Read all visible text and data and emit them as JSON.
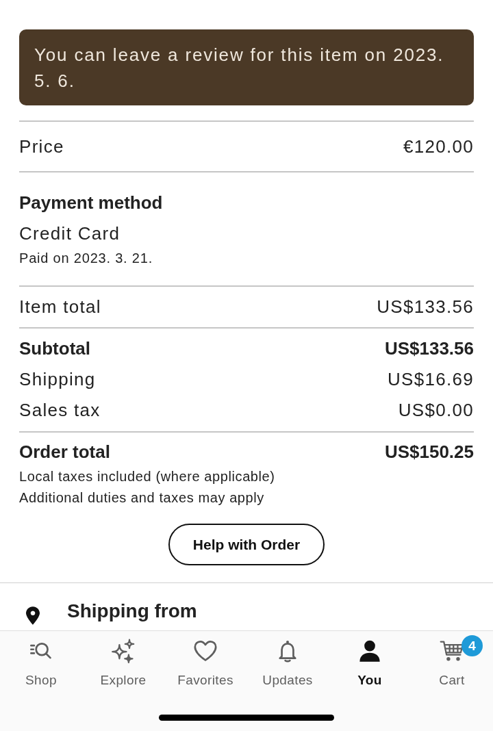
{
  "review_notice": {
    "text": "You can leave a review for this item on 2023. 5. 6."
  },
  "price": {
    "label": "Price",
    "value": "€120.00"
  },
  "payment_method": {
    "heading": "Payment method",
    "method": "Credit Card",
    "paid_on": "Paid on 2023. 3. 21."
  },
  "item_total": {
    "label": "Item total",
    "value": "US$133.56"
  },
  "charges": [
    {
      "label": "Subtotal",
      "value": "US$133.56",
      "emphasized": true
    },
    {
      "label": "Shipping",
      "value": "US$16.69",
      "emphasized": false
    },
    {
      "label": "Sales tax",
      "value": "US$0.00",
      "emphasized": false
    }
  ],
  "order_total": {
    "label": "Order total",
    "value": "US$150.25",
    "notes": [
      "Local taxes included (where applicable)",
      "Additional duties and taxes may apply"
    ]
  },
  "help_button": {
    "label": "Help with Order"
  },
  "shipping_from": {
    "heading": "Shipping from"
  },
  "bottom_nav": [
    {
      "kind": "shop",
      "label": "Shop",
      "selected": false
    },
    {
      "kind": "explore",
      "label": "Explore",
      "selected": false
    },
    {
      "kind": "favorites",
      "label": "Favorites",
      "selected": false
    },
    {
      "kind": "updates",
      "label": "Updates",
      "selected": false
    },
    {
      "kind": "you",
      "label": "You",
      "selected": true
    },
    {
      "kind": "cart",
      "label": "Cart",
      "selected": false,
      "badge": "4"
    }
  ]
}
